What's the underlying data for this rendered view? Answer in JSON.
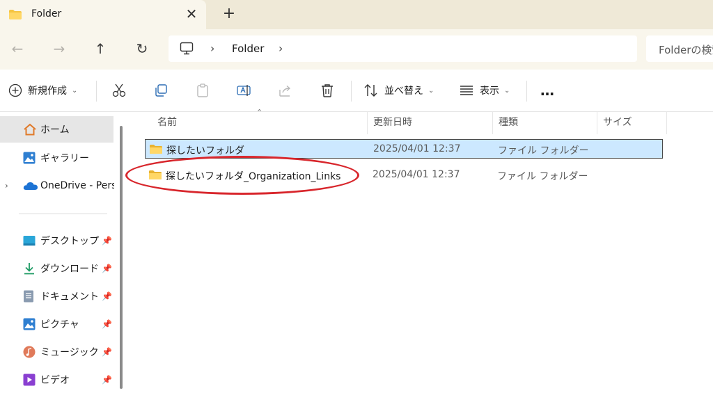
{
  "tab": {
    "title": "Folder",
    "close": "✕",
    "new": "+"
  },
  "nav": {
    "back": "←",
    "forward": "→",
    "up": "↑",
    "refresh": "↻"
  },
  "address": {
    "chevron": "›",
    "folder": "Folder",
    "search_placeholder": "Folderの検索"
  },
  "toolbar": {
    "new_label": "新規作成",
    "sort_label": "並べ替え",
    "view_label": "表示",
    "more_label": "…"
  },
  "sidebar": {
    "items": [
      {
        "label": "ホーム",
        "icon": "home-icon"
      },
      {
        "label": "ギャラリー",
        "icon": "gallery-icon"
      },
      {
        "label": "OneDrive - Perso",
        "icon": "onedrive-icon"
      },
      {
        "label": "デスクトップ",
        "icon": "desktop-icon"
      },
      {
        "label": "ダウンロード",
        "icon": "download-icon"
      },
      {
        "label": "ドキュメント",
        "icon": "documents-icon"
      },
      {
        "label": "ピクチャ",
        "icon": "pictures-icon"
      },
      {
        "label": "ミュージック",
        "icon": "music-icon"
      },
      {
        "label": "ビデオ",
        "icon": "videos-icon"
      }
    ],
    "pin": "📌",
    "expand": "›"
  },
  "columns": {
    "name": "名前",
    "date": "更新日時",
    "type": "種類",
    "size": "サイズ"
  },
  "files": [
    {
      "name": "探したいフォルダ",
      "date": "2025/04/01 12:37",
      "type": "ファイル フォルダー"
    },
    {
      "name": "探したいフォルダ_Organization_Links",
      "date": "2025/04/01 12:37",
      "type": "ファイル フォルダー"
    }
  ],
  "colors": {
    "folder": "#f5c441",
    "selection": "#cce8ff",
    "annotation": "#d8262c",
    "tab_bg": "#efe9d7",
    "nav_bg": "#f9f6ec"
  }
}
